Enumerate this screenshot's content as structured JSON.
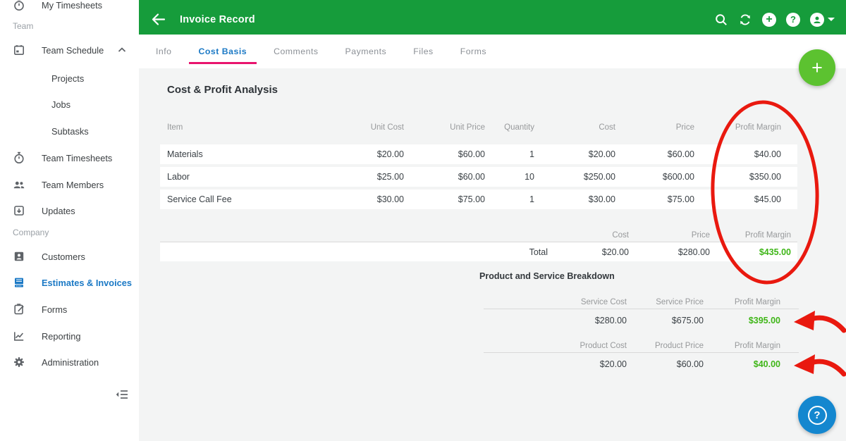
{
  "header": {
    "title": "Invoice Record",
    "glyphs": {
      "add": "+",
      "help": "?"
    }
  },
  "tabs": [
    "Info",
    "Cost Basis",
    "Comments",
    "Payments",
    "Files",
    "Forms"
  ],
  "active_tab": "Cost Basis",
  "sidebar": {
    "items": [
      {
        "label": "My Timesheets"
      },
      {
        "label": "Team"
      },
      {
        "label": "Team Schedule"
      },
      {
        "label": "Projects"
      },
      {
        "label": "Jobs"
      },
      {
        "label": "Subtasks"
      },
      {
        "label": "Team Timesheets"
      },
      {
        "label": "Team Members"
      },
      {
        "label": "Updates"
      },
      {
        "label": "Company"
      },
      {
        "label": "Customers"
      },
      {
        "label": "Estimates & Invoices"
      },
      {
        "label": "Forms"
      },
      {
        "label": "Reporting"
      },
      {
        "label": "Administration"
      }
    ]
  },
  "main": {
    "heading": "Cost & Profit Analysis",
    "table": {
      "columns": [
        "Item",
        "Unit Cost",
        "Unit Price",
        "Quantity",
        "Cost",
        "Price",
        "Profit Margin"
      ],
      "rows": [
        [
          "Materials",
          "$20.00",
          "$60.00",
          "1",
          "$20.00",
          "$60.00",
          "$40.00"
        ],
        [
          "Labor",
          "$25.00",
          "$60.00",
          "10",
          "$250.00",
          "$600.00",
          "$350.00"
        ],
        [
          "Service Call Fee",
          "$30.00",
          "$75.00",
          "1",
          "$30.00",
          "$75.00",
          "$45.00"
        ]
      ]
    },
    "totals": {
      "columns": [
        "Cost",
        "Price",
        "Profit Margin"
      ],
      "row_label": "Total",
      "values": [
        "$20.00",
        "$280.00",
        "$435.00"
      ]
    },
    "breakdown": {
      "heading": "Product and Service Breakdown",
      "service": {
        "columns": [
          "Service Cost",
          "Service Price",
          "Profit Margin"
        ],
        "values": [
          "$280.00",
          "$675.00",
          "$395.00"
        ]
      },
      "product": {
        "columns": [
          "Product Cost",
          "Product Price",
          "Profit Margin"
        ],
        "values": [
          "$20.00",
          "$60.00",
          "$40.00"
        ]
      }
    }
  },
  "fab": {
    "add": "+",
    "help": "?"
  },
  "colors": {
    "header_green": "#169c3b",
    "fab_green": "#5cc230",
    "profit_green": "#3fb618",
    "accent_blue": "#1b79c5",
    "help_blue": "#1487cf",
    "tab_underline_pink": "#e8146e",
    "annotation_red": "#e9190f"
  }
}
